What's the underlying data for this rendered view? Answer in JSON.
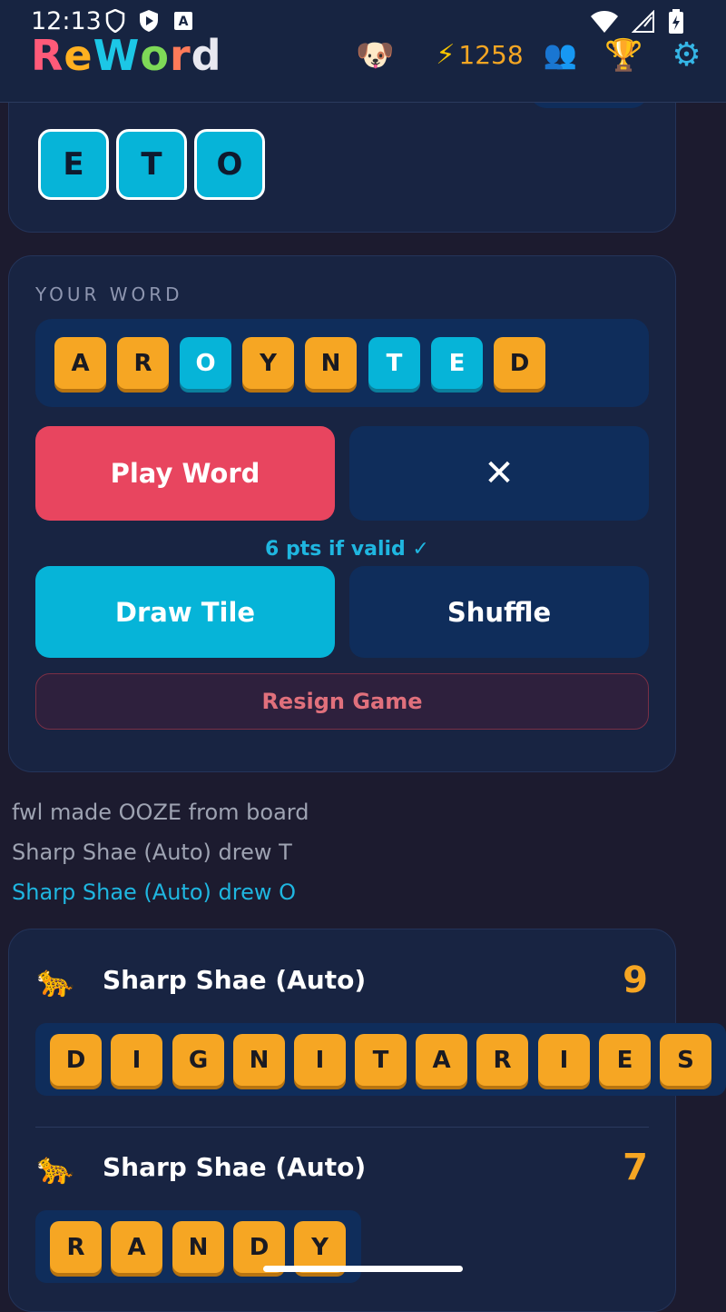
{
  "status_bar": {
    "time": "12:13"
  },
  "app": {
    "logo_letters": [
      {
        "ch": "R",
        "color": "#ff5a79"
      },
      {
        "ch": "e",
        "color": "#ffb020"
      },
      {
        "ch": "W",
        "color": "#1cc7e6"
      },
      {
        "ch": "o",
        "color": "#7ed957"
      },
      {
        "ch": "r",
        "color": "#ff7a59"
      },
      {
        "ch": "d",
        "color": "#e8e8f0"
      }
    ],
    "avatar_emoji": "🐶",
    "energy": "1258",
    "bolt": "⚡",
    "friends_icon": "👥",
    "trophy_icon": "🏆",
    "settings_icon": "⚙"
  },
  "board": {
    "tiles": [
      "E",
      "T",
      "O"
    ]
  },
  "your_word": {
    "label": "YOUR WORD",
    "tiles": [
      {
        "letter": "A",
        "color": "orange"
      },
      {
        "letter": "R",
        "color": "orange"
      },
      {
        "letter": "O",
        "color": "cyan"
      },
      {
        "letter": "Y",
        "color": "orange"
      },
      {
        "letter": "N",
        "color": "orange"
      },
      {
        "letter": "T",
        "color": "cyan"
      },
      {
        "letter": "E",
        "color": "cyan"
      },
      {
        "letter": "D",
        "color": "orange"
      }
    ],
    "play_label": "Play Word",
    "clear_label": "✕",
    "hint": "6 pts if valid ✓",
    "draw_label": "Draw Tile",
    "shuffle_label": "Shuffle",
    "resign_label": "Resign Game"
  },
  "log": [
    "fwl made OOZE from board",
    "Sharp Shae (Auto) drew T",
    "Sharp Shae (Auto) drew O"
  ],
  "plays": [
    {
      "emoji": "🐆",
      "player": "Sharp Shae (Auto)",
      "score": "9",
      "letters": [
        "D",
        "I",
        "G",
        "N",
        "I",
        "T",
        "A",
        "R",
        "I",
        "E",
        "S"
      ]
    },
    {
      "emoji": "🐆",
      "player": "Sharp Shae (Auto)",
      "score": "7",
      "letters": [
        "R",
        "A",
        "N",
        "D",
        "Y"
      ]
    }
  ],
  "colors": {
    "accent_cyan": "#06b4d8",
    "accent_orange": "#f6a623",
    "accent_red": "#e8455f",
    "background": "#1c1b2f"
  }
}
